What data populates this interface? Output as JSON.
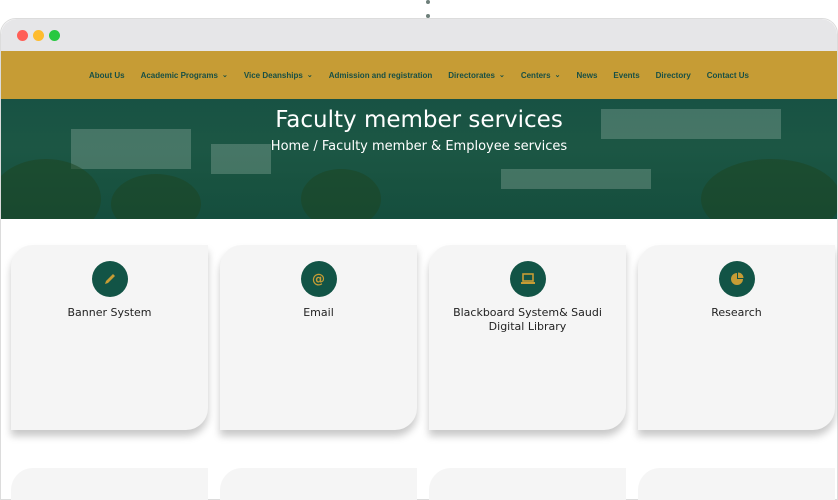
{
  "nav": {
    "items": [
      {
        "label": "About Us",
        "dropdown": false
      },
      {
        "label": "Academic Programs",
        "dropdown": true
      },
      {
        "label": "Vice Deanships",
        "dropdown": true
      },
      {
        "label": "Admission and registration",
        "dropdown": false
      },
      {
        "label": "Directorates",
        "dropdown": true
      },
      {
        "label": "Centers",
        "dropdown": true
      },
      {
        "label": "News",
        "dropdown": false
      },
      {
        "label": "Events",
        "dropdown": false
      },
      {
        "label": "Directory",
        "dropdown": false
      },
      {
        "label": "Contact Us",
        "dropdown": false
      }
    ]
  },
  "hero": {
    "title": "Faculty member services",
    "breadcrumb": "Home / Faculty member & Employee services"
  },
  "services": [
    {
      "label": "Banner System",
      "icon": "pencil-icon"
    },
    {
      "label": "Email",
      "icon": "at-sign-icon"
    },
    {
      "label": "Blackboard System& Saudi Digital Library",
      "icon": "laptop-icon"
    },
    {
      "label": "Research",
      "icon": "pie-chart-icon"
    }
  ],
  "colors": {
    "nav_bg": "#c69c35",
    "nav_text": "#174f45",
    "accent": "#125446",
    "icon_glyph": "#c69c35",
    "card_bg": "#f5f5f5"
  }
}
